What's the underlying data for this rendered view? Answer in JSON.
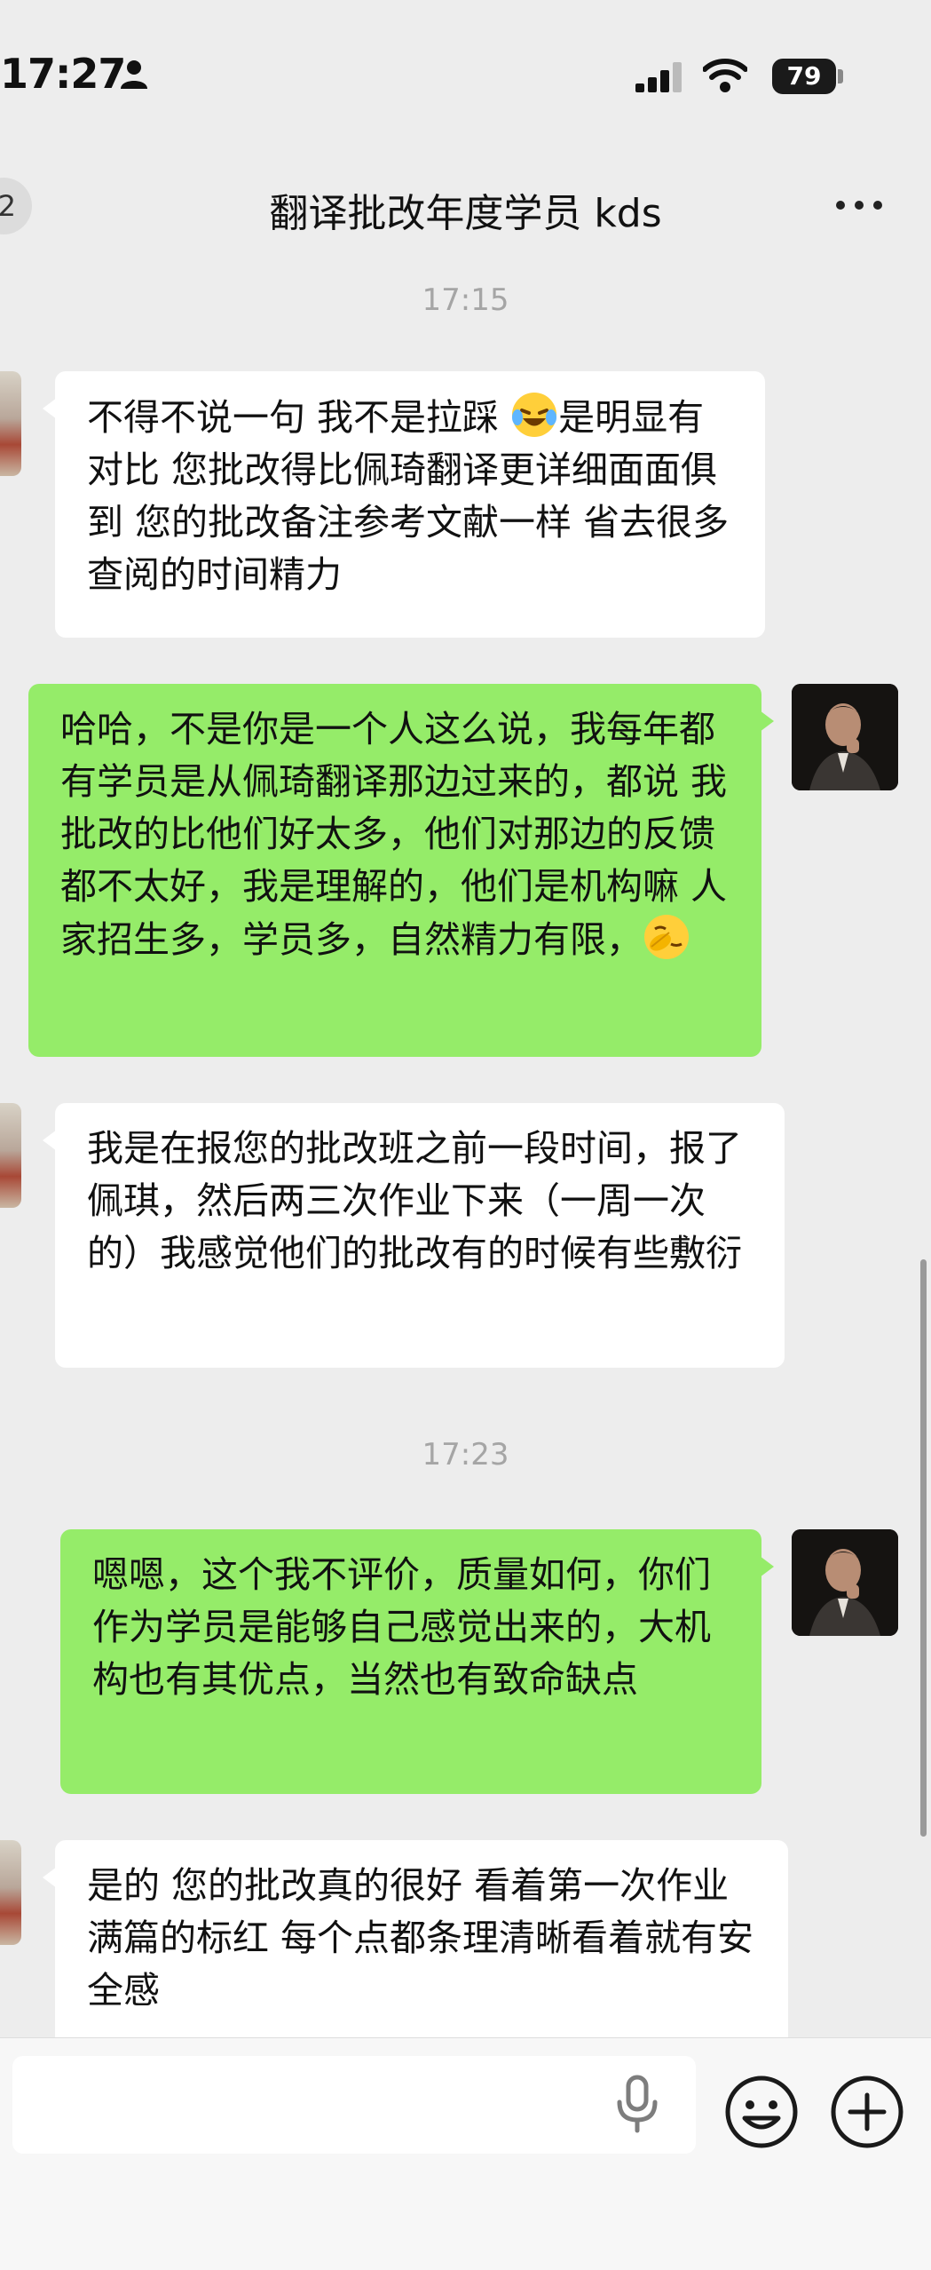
{
  "status_bar": {
    "time": "17:27",
    "battery": "79",
    "icons": [
      "person-icon",
      "cellular-signal-icon",
      "wifi-icon",
      "battery-icon"
    ]
  },
  "nav": {
    "back_badge": "2",
    "title": "翻译批改年度学员 kds",
    "more_icon": "more-dots-icon"
  },
  "timestamps": [
    "17:15",
    "17:23"
  ],
  "messages": [
    {
      "side": "left",
      "text_before_emoji": "不得不说一句 我不是拉踩 ",
      "emoji": "laughing-crying-emoji",
      "text_after_emoji": "是明显有对比 您批改得比佩琦翻译更详细面面俱到 您的批改备注参考文献一样 省去很多查阅的时间精力"
    },
    {
      "side": "right",
      "text_before_emoji": "哈哈，不是你是一个人这么说，我每年都有学员是从佩琦翻译那边过来的，都说 我批改的比他们好太多，他们对那边的反馈都不太好，我是理解的，他们是机构嘛 人家招生多，学员多，自然精力有限，",
      "emoji": "facepalm-emoji",
      "text_after_emoji": ""
    },
    {
      "side": "left",
      "text": "我是在报您的批改班之前一段时间，报了佩琪，然后两三次作业下来（一周一次的）我感觉他们的批改有的时候有些敷衍"
    },
    {
      "side": "right",
      "text": "嗯嗯，这个我不评价，质量如何，你们作为学员是能够自己感觉出来的，大机构也有其优点，当然也有致命缺点"
    },
    {
      "side": "left",
      "text": "是的 您的批改真的很好 看着第一次作业满篇的标红 每个点都条理清晰看着就有安全感"
    }
  ],
  "input_bar": {
    "value": "",
    "placeholder": "",
    "icons": [
      "microphone-icon",
      "emoji-icon",
      "plus-icon"
    ]
  },
  "colors": {
    "background": "#ededed",
    "sent_bubble": "#95ec69",
    "received_bubble": "#ffffff",
    "timestamp_text": "#a5a5a5"
  }
}
